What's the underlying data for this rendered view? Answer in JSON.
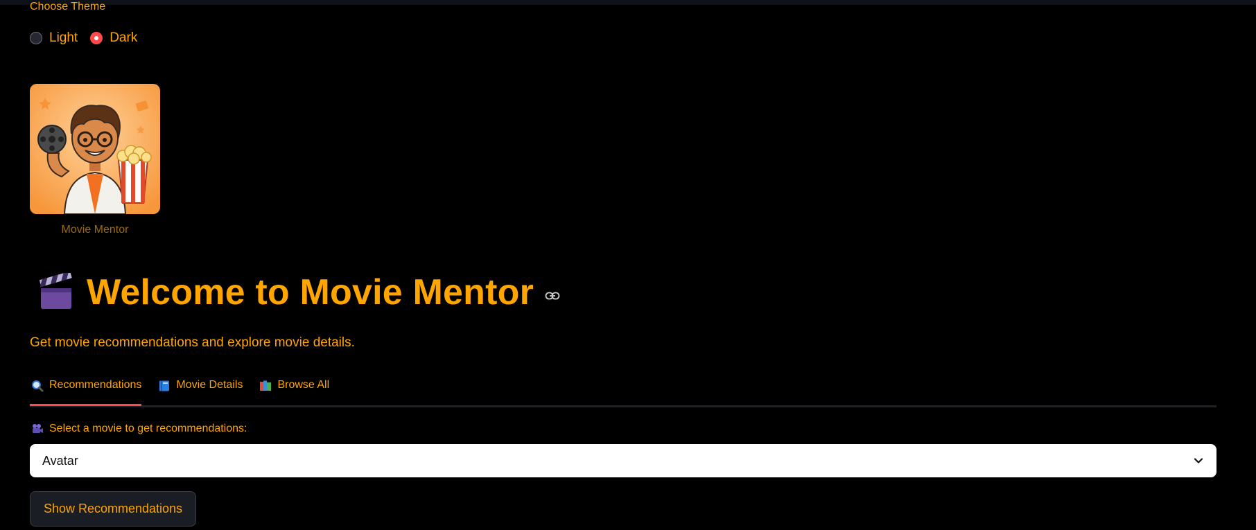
{
  "theme": {
    "label": "Choose Theme",
    "options": [
      {
        "label": "Light",
        "checked": false
      },
      {
        "label": "Dark",
        "checked": true
      }
    ]
  },
  "logo": {
    "caption": "Movie Mentor"
  },
  "header": {
    "title": "Welcome to Movie Mentor",
    "subtitle": "Get movie recommendations and explore movie details."
  },
  "tabs": [
    {
      "icon": "magnifier-icon",
      "label": "Recommendations",
      "active": true
    },
    {
      "icon": "blue-book-icon",
      "label": "Movie Details",
      "active": false
    },
    {
      "icon": "books-icon",
      "label": "Browse All",
      "active": false
    }
  ],
  "recommendations": {
    "select_label": "Select a movie to get recommendations:",
    "selected_movie": "Avatar",
    "button_label": "Show Recommendations"
  },
  "colors": {
    "background": "#000000",
    "accent_text": "#ffa500",
    "tab_indicator": "#ff4b4b",
    "radio_checked": "#ff4b4b"
  }
}
